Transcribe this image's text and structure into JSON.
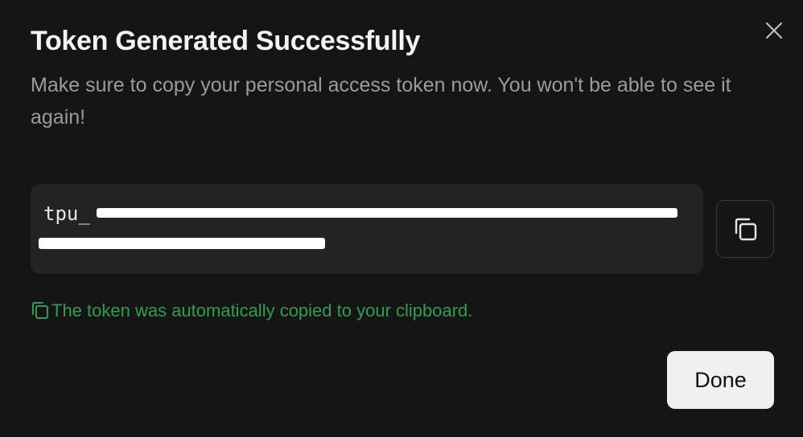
{
  "dialog": {
    "title": "Token Generated Successfully",
    "description": "Make sure to copy your personal access token now. You won't be able to see it again!",
    "token": {
      "visible_prefix": "tpu_",
      "redacted": true
    },
    "copied_message": "The token was automatically copied to your clipboard.",
    "done_label": "Done",
    "icons": {
      "close": "close-icon",
      "copy": "copy-icon",
      "copied": "copy-icon"
    },
    "colors": {
      "background": "#151516",
      "token_box": "#232325",
      "success": "#2f9e52",
      "primary_button_bg": "#f0f0f0"
    }
  }
}
